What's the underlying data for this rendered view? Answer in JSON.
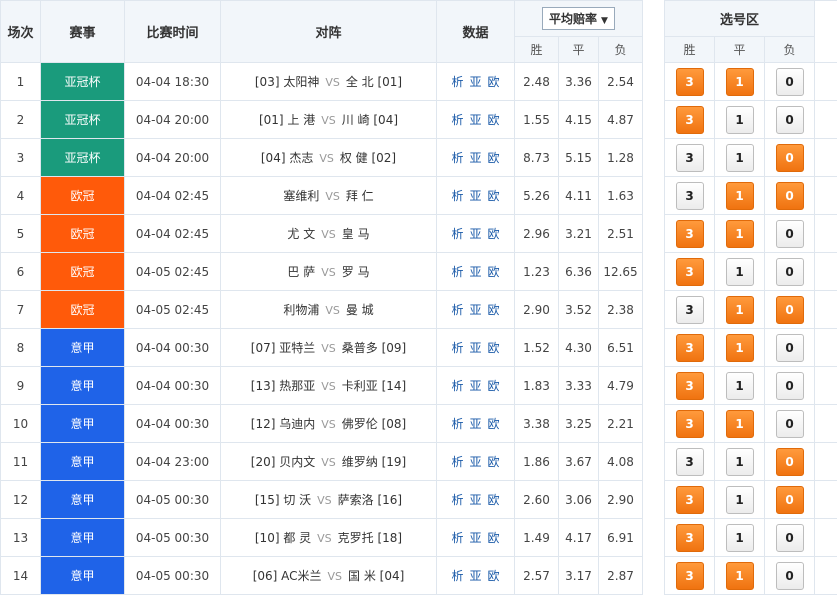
{
  "header": {
    "col_index": "场次",
    "col_league": "赛事",
    "col_time": "比赛时间",
    "col_match": "对阵",
    "col_data": "数据",
    "odds_select": "平均赔率",
    "col_pick": "选号区",
    "win": "胜",
    "draw": "平",
    "lose": "负",
    "vs": "VS"
  },
  "league_colors": {
    "亚冠杯": "#1a9b7c",
    "欧冠": "#ff5a0a",
    "意甲": "#1f63e8"
  },
  "rows": [
    {
      "idx": "1",
      "league": "亚冠杯",
      "color": "#1a9b7c",
      "time": "04-04 18:30",
      "home": "[03] 太阳神",
      "away": "全 北 [01]",
      "data": "析亚欧",
      "w": "2.48",
      "d": "3.36",
      "l": "2.54",
      "picks": [
        true,
        true,
        false
      ]
    },
    {
      "idx": "2",
      "league": "亚冠杯",
      "color": "#1a9b7c",
      "time": "04-04 20:00",
      "home": "[01] 上 港",
      "away": "川 崎 [04]",
      "data": "析亚欧",
      "w": "1.55",
      "d": "4.15",
      "l": "4.87",
      "picks": [
        true,
        false,
        false
      ]
    },
    {
      "idx": "3",
      "league": "亚冠杯",
      "color": "#1a9b7c",
      "time": "04-04 20:00",
      "home": "[04]  杰志",
      "away": "权 健 [02]",
      "data": "析亚欧",
      "w": "8.73",
      "d": "5.15",
      "l": "1.28",
      "picks": [
        false,
        false,
        true
      ]
    },
    {
      "idx": "4",
      "league": "欧冠",
      "color": "#ff5a0a",
      "time": "04-04 02:45",
      "home": "塞维利",
      "away": "拜 仁",
      "data": "析亚欧",
      "w": "5.26",
      "d": "4.11",
      "l": "1.63",
      "picks": [
        false,
        true,
        true
      ]
    },
    {
      "idx": "5",
      "league": "欧冠",
      "color": "#ff5a0a",
      "time": "04-04 02:45",
      "home": "尤 文",
      "away": "皇 马",
      "data": "析亚欧",
      "w": "2.96",
      "d": "3.21",
      "l": "2.51",
      "picks": [
        true,
        true,
        false
      ]
    },
    {
      "idx": "6",
      "league": "欧冠",
      "color": "#ff5a0a",
      "time": "04-05 02:45",
      "home": "巴 萨",
      "away": "罗 马",
      "data": "析亚欧",
      "w": "1.23",
      "d": "6.36",
      "l": "12.65",
      "picks": [
        true,
        false,
        false
      ]
    },
    {
      "idx": "7",
      "league": "欧冠",
      "color": "#ff5a0a",
      "time": "04-05 02:45",
      "home": "利物浦",
      "away": "曼 城",
      "data": "析亚欧",
      "w": "2.90",
      "d": "3.52",
      "l": "2.38",
      "picks": [
        false,
        true,
        true
      ]
    },
    {
      "idx": "8",
      "league": "意甲",
      "color": "#1f63e8",
      "time": "04-04 00:30",
      "home": "[07] 亚特兰",
      "away": "桑普多 [09]",
      "data": "析亚欧",
      "w": "1.52",
      "d": "4.30",
      "l": "6.51",
      "picks": [
        true,
        true,
        false
      ]
    },
    {
      "idx": "9",
      "league": "意甲",
      "color": "#1f63e8",
      "time": "04-04 00:30",
      "home": "[13] 热那亚",
      "away": "卡利亚 [14]",
      "data": "析亚欧",
      "w": "1.83",
      "d": "3.33",
      "l": "4.79",
      "picks": [
        true,
        false,
        false
      ]
    },
    {
      "idx": "10",
      "league": "意甲",
      "color": "#1f63e8",
      "time": "04-04 00:30",
      "home": "[12] 乌迪内",
      "away": "佛罗伦 [08]",
      "data": "析亚欧",
      "w": "3.38",
      "d": "3.25",
      "l": "2.21",
      "picks": [
        true,
        true,
        false
      ]
    },
    {
      "idx": "11",
      "league": "意甲",
      "color": "#1f63e8",
      "time": "04-04 23:00",
      "home": "[20] 贝内文",
      "away": "维罗纳 [19]",
      "data": "析亚欧",
      "w": "1.86",
      "d": "3.67",
      "l": "4.08",
      "picks": [
        false,
        false,
        true
      ]
    },
    {
      "idx": "12",
      "league": "意甲",
      "color": "#1f63e8",
      "time": "04-05 00:30",
      "home": "[15] 切 沃",
      "away": "萨索洛 [16]",
      "data": "析亚欧",
      "w": "2.60",
      "d": "3.06",
      "l": "2.90",
      "picks": [
        true,
        false,
        true
      ]
    },
    {
      "idx": "13",
      "league": "意甲",
      "color": "#1f63e8",
      "time": "04-05 00:30",
      "home": "[10] 都 灵",
      "away": "克罗托 [18]",
      "data": "析亚欧",
      "w": "1.49",
      "d": "4.17",
      "l": "6.91",
      "picks": [
        true,
        false,
        false
      ]
    },
    {
      "idx": "14",
      "league": "意甲",
      "color": "#1f63e8",
      "time": "04-05 00:30",
      "home": "[06] AC米兰",
      "away": "国 米 [04]",
      "data": "析亚欧",
      "w": "2.57",
      "d": "3.17",
      "l": "2.87",
      "picks": [
        true,
        true,
        false
      ]
    }
  ],
  "pick_labels": [
    "3",
    "1",
    "0"
  ]
}
